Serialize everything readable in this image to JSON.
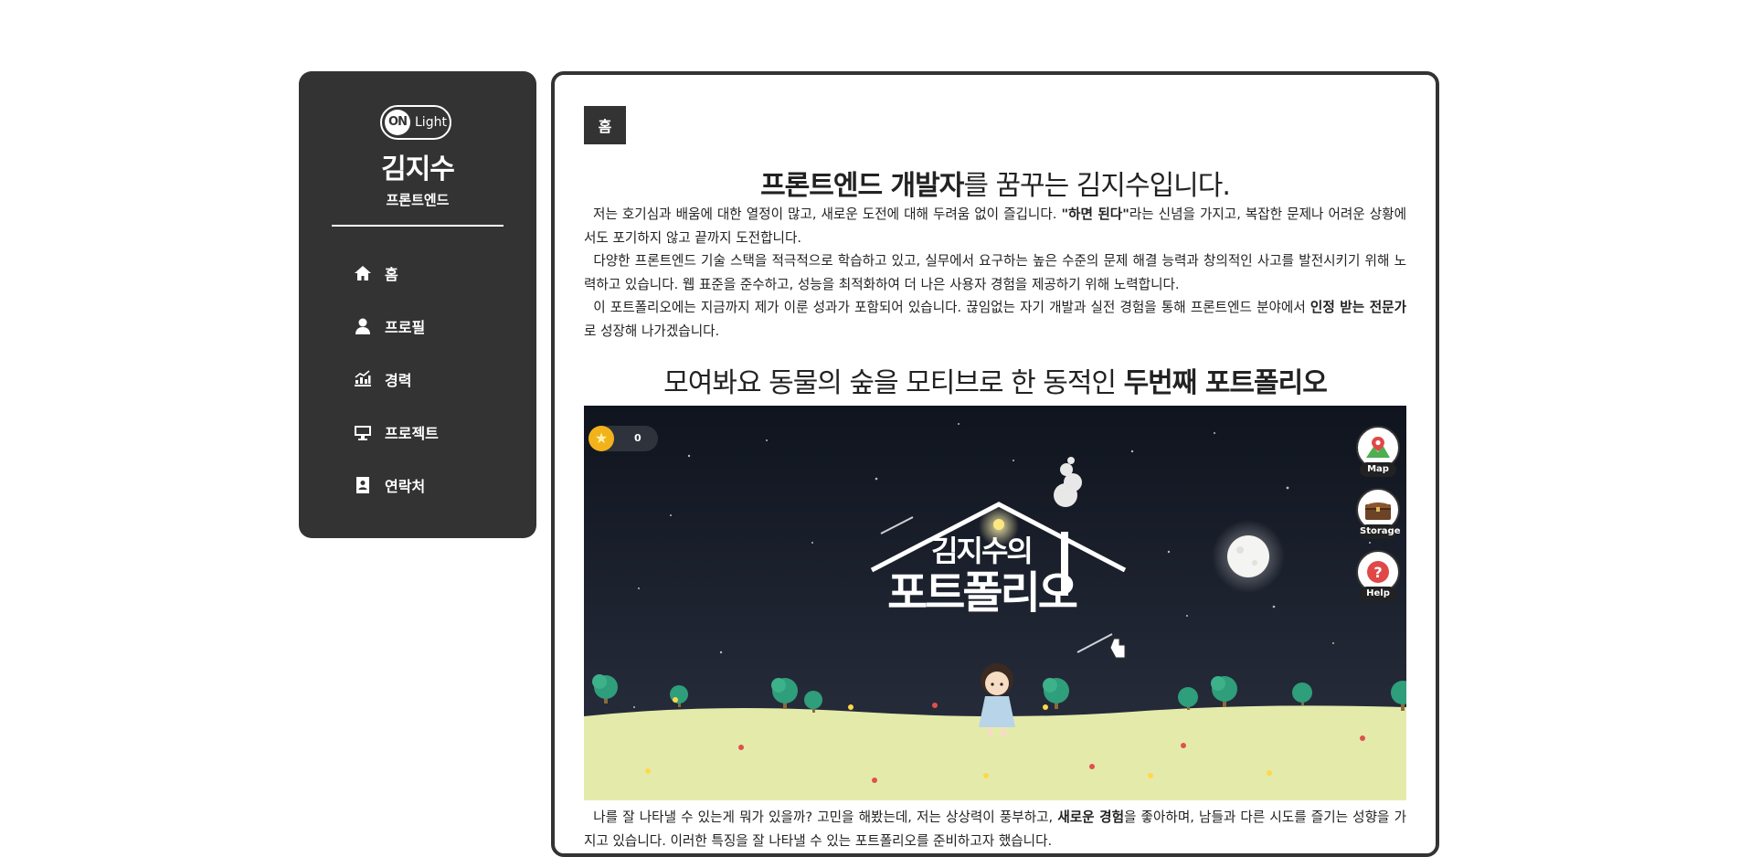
{
  "sidebar": {
    "toggle": {
      "on_label": "ON",
      "light_label": "Light"
    },
    "name": "김지수",
    "role": "프론트엔드",
    "items": [
      {
        "label": "홈",
        "icon": "home-icon"
      },
      {
        "label": "프로필",
        "icon": "user-icon"
      },
      {
        "label": "경력",
        "icon": "chart-icon"
      },
      {
        "label": "프로젝트",
        "icon": "monitor-icon"
      },
      {
        "label": "연락처",
        "icon": "contact-icon"
      }
    ]
  },
  "main": {
    "badge": "홈",
    "heading1": {
      "bold": "프론트엔드 개발자",
      "rest": "를 꿈꾸는 김지수입니다."
    },
    "intro": {
      "p1_a": "저는 호기심과 배움에 대한 열정이 많고, 새로운 도전에 대해 두려움 없이 즐깁니다. ",
      "p1_bold": "\"하면 된다\"",
      "p1_b": "라는 신념을 가지고, 복잡한 문제나 어려운 상황에서도 포기하지 않고 끝까지 도전합니다.",
      "p2": "다양한 프론트엔드 기술 스택을 적극적으로 학습하고 있고, 실무에서 요구하는 높은 수준의 문제 해결 능력과 창의적인 사고를 발전시키기 위해 노력하고 있습니다. 웹 표준을 준수하고, 성능을 최적화하여 더 나은 사용자 경험을 제공하기 위해 노력합니다.",
      "p3_a": "이 포트폴리오에는 지금까지 제가 이룬 성과가 포함되어 있습니다. 끊임없는 자기 개발과 실전 경험을 통해 프론트엔드 분야에서 ",
      "p3_bold": "인정 받는 전문가",
      "p3_b": "로 성장해 나가겠습니다."
    },
    "heading2": {
      "rest": "모여봐요 동물의 숲을 모티브로 한 동적인 ",
      "bold": "두번째 포트폴리오"
    },
    "scene": {
      "coin_count": "0",
      "title_line1": "김지수의",
      "title_line2": "포트폴리오",
      "buttons": [
        {
          "label": "Map",
          "icon": "map-pin-icon"
        },
        {
          "label": "Storage",
          "icon": "chest-icon"
        },
        {
          "label": "Help",
          "icon": "question-icon"
        }
      ]
    },
    "outro": {
      "a": "나를 잘 나타낼 수 있는게 뭐가 있을까? 고민을 해봤는데, 저는 상상력이 풍부하고, ",
      "bold": "새로운 경험",
      "b": "을 좋아하며, 남들과 다른 시도를 즐기는 성향을 가지고 있습니다. 이러한 특징을 잘 나타낼 수 있는 포트폴리오를 준비하고자 했습니다."
    }
  },
  "colors": {
    "sidebar_bg": "#333333",
    "scene_sky": "#141a26",
    "grass": "#e4ebaa",
    "tree": "#2f9e7a"
  }
}
